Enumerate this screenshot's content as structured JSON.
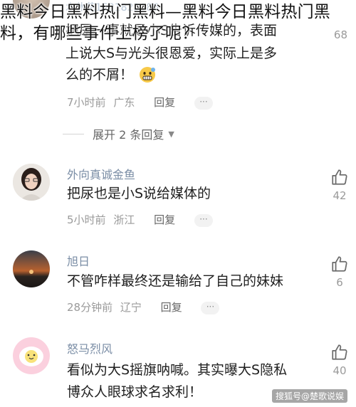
{
  "overlay": {
    "title": "黑料今日黑料热门黑料—黑料今日黑料热门黑料，有哪些事件上榜了呢？"
  },
  "top_comment": {
    "username": "水休花1521822086",
    "text_line1": "把尿一事就是小S告诉传媒的，表面",
    "text_line2": "上说大S与光头很恩爱，实际上是多",
    "text_line3": "么的不屑！",
    "emoji": "grimace-emoji",
    "time": "7小时前",
    "location": "广东",
    "reply_label": "回复",
    "more_label": "···",
    "like_count": "68"
  },
  "expand": {
    "label": "展开 2 条回复"
  },
  "comments": [
    {
      "username": "外向真诚金鱼",
      "text_lines": [
        "把尿也是小S说给媒体的"
      ],
      "time": "5小时前",
      "location": "浙江",
      "reply_label": "回复",
      "more_label": "···",
      "like_count": "42"
    },
    {
      "username": "旭日",
      "text_lines": [
        "不管咋样最终还是输给了自己的妹妹"
      ],
      "time": "28分钟前",
      "location": "辽宁",
      "reply_label": "回复",
      "more_label": "···",
      "like_count": "6"
    },
    {
      "username": "怒马烈风",
      "text_lines": [
        "看似为大S摇旗呐喊。其实曝大S隐私",
        "博众人眼球求名求利！"
      ],
      "like_count": "40"
    }
  ],
  "watermark": "搜狐号@楚歌说娱",
  "icons": {
    "like": "thumbs-up-icon",
    "expand": "caret-down-icon"
  }
}
